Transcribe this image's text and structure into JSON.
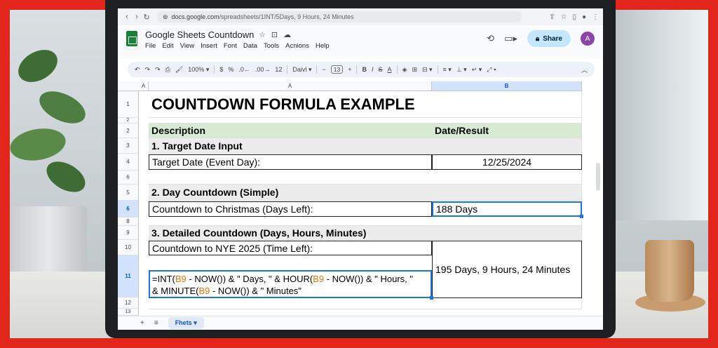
{
  "browser": {
    "url_host": "docs.google.com",
    "url_path": "/spreadsheets/1INT/5Days, 9 Hours, 24 Minutes"
  },
  "app": {
    "title": "Google Sheets Countdown",
    "menus": [
      "File",
      "Edit",
      "View",
      "Insert",
      "Font",
      "Data",
      "Tools",
      "Acnions",
      "Help"
    ],
    "share_label": "Share",
    "avatar_initial": "A"
  },
  "toolbar": {
    "zoom": "100%",
    "currency": "$",
    "percent": "%",
    "font_size_label": "12",
    "font_name": "Daivl",
    "font_size": "13"
  },
  "grid": {
    "col_a_small": "A",
    "col_a": "A",
    "col_b": "B",
    "row_labels": [
      "1",
      "2",
      "2",
      "3",
      "4",
      "6",
      "5",
      "6",
      "8",
      "9",
      "10",
      "11",
      "12",
      "13"
    ],
    "title": "COUNTDOWN FORMULA EXAMPLE",
    "header_desc": "Description",
    "header_result": "Date/Result",
    "section1": "1. Target Date Input",
    "target_label": "Target Date (Event Day):",
    "target_value": "12/25/2024",
    "section2": "2. Day Countdown (Simple)",
    "simple_label": "Countdown to Christmas (Days Left):",
    "simple_value": "188 Days",
    "section3": "3. Detailed Countdown (Days, Hours, Minutes)",
    "detailed_label": "Countdown to NYE 2025 (Time Left):",
    "detailed_value": "195 Days, 9 Hours, 24 Minutes",
    "formula": {
      "line1_a": "=INT(",
      "ref1": "B9",
      "line1_b": " - NOW()) & \" Days, \" & HOUR(",
      "ref2": "B9",
      "line1_c": " - NOW()) & \" Hours, \"",
      "line2_a": "& MINUTE(",
      "ref3": "B9",
      "line2_b": " - NOW()) & \" Minutes\""
    }
  },
  "sheet_tabs": {
    "add": "+",
    "list": "≡",
    "active": "Fhets"
  },
  "colors": {
    "frame": "#e3261c",
    "accent": "#1a73e8",
    "header_green": "#d9ead3",
    "ref_orange": "#e37400",
    "share_bg": "#c2e7ff"
  }
}
